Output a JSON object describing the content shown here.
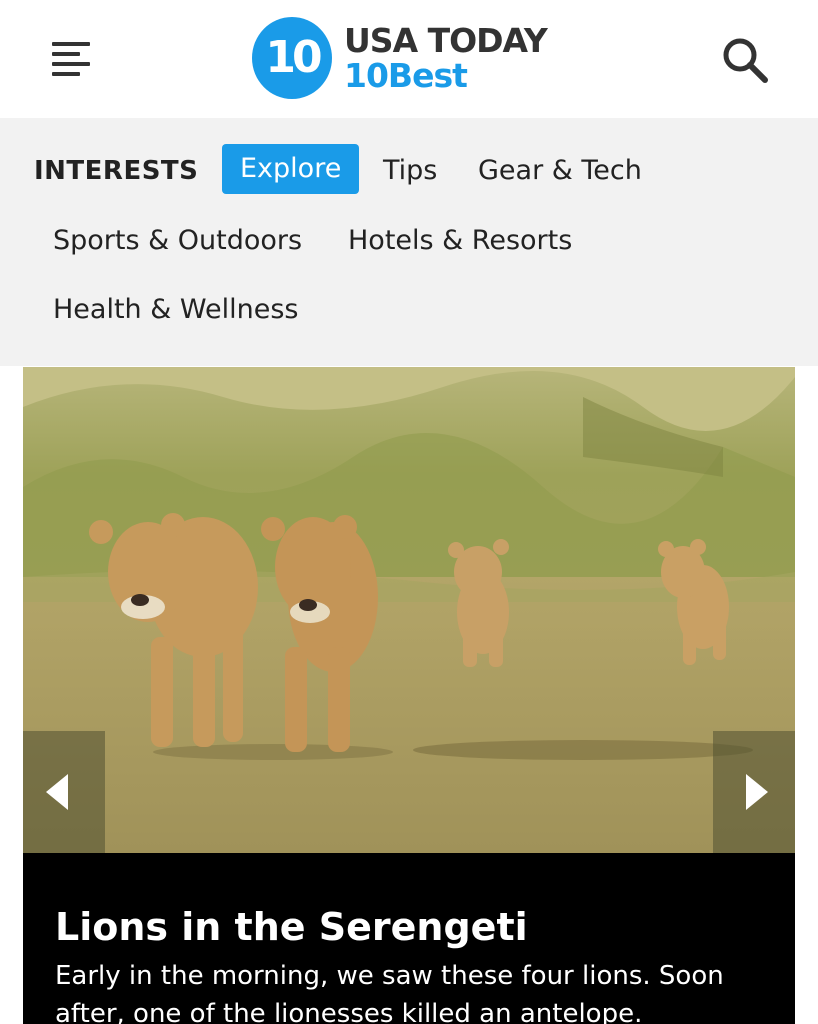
{
  "header": {
    "logo_badge": "10",
    "logo_line1": "USA TODAY",
    "logo_line2": "10Best",
    "brand_color": "#1a9be8",
    "menu_icon": "hamburger-menu-icon",
    "search_icon": "search-icon"
  },
  "nav": {
    "heading": "INTERESTS",
    "items": [
      {
        "label": "Explore",
        "active": true
      },
      {
        "label": "Tips",
        "active": false
      },
      {
        "label": "Gear & Tech",
        "active": false
      },
      {
        "label": "Sports & Outdoors",
        "active": false
      },
      {
        "label": "Hotels & Resorts",
        "active": false
      },
      {
        "label": "Health & Wellness",
        "active": false
      }
    ]
  },
  "slideshow": {
    "prev_icon": "chevron-left-icon",
    "next_icon": "chevron-right-icon",
    "title": "Lions in the Serengeti",
    "description": "Early in the morning, we saw these four lions. Soon after, one of the lionesses killed an antelope."
  }
}
